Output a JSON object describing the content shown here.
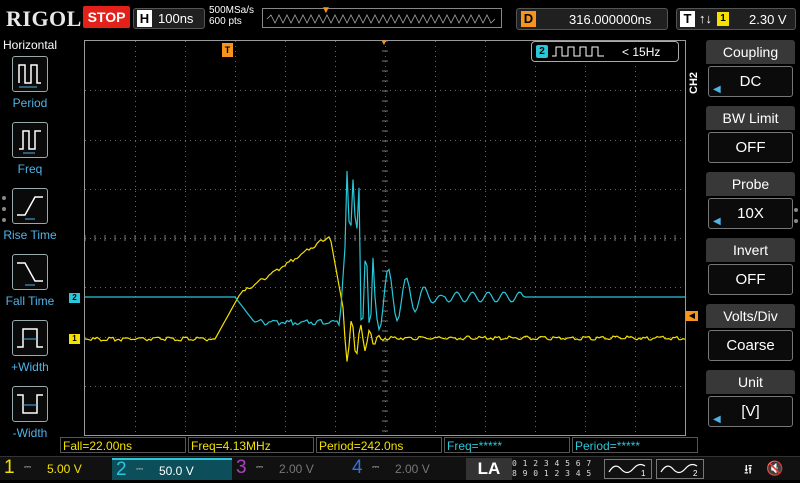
{
  "brand": {
    "logo": "RIGOL",
    "run_state": "STOP"
  },
  "horizontal": {
    "label": "H",
    "timebase": "100ns",
    "sample_rate": "500MSa/s",
    "memory_depth": "600 pts"
  },
  "delay": {
    "label": "D",
    "value": "316.000000ns"
  },
  "trigger": {
    "label": "T",
    "edge_symbol": "↑↓",
    "source": "1",
    "level": "2.30 V"
  },
  "left_menu": {
    "title": "Horizontal",
    "items": [
      {
        "label": "Period",
        "icon": "period-icon"
      },
      {
        "label": "Freq",
        "icon": "freq-icon"
      },
      {
        "label": "Rise Time",
        "icon": "rise-time-icon"
      },
      {
        "label": "Fall Time",
        "icon": "fall-time-icon"
      },
      {
        "label": "+Width",
        "icon": "positive-width-icon"
      },
      {
        "label": "-Width",
        "icon": "negative-width-icon"
      }
    ]
  },
  "generator": {
    "channel": "2",
    "freq": "< 15Hz"
  },
  "markers": {
    "trigger_pos": "T",
    "ch2": "2",
    "ch1": "1"
  },
  "measurements": [
    {
      "text": "Fall=22.00ns",
      "color": "#f5e100"
    },
    {
      "text": "Freq=4.13MHz",
      "color": "#f5e100"
    },
    {
      "text": "Period=242.0ns",
      "color": "#f5e100"
    },
    {
      "text": "Freq=*****",
      "color": "#28c7d9"
    },
    {
      "text": "Period=*****",
      "color": "#28c7d9"
    }
  ],
  "right_menu": {
    "channel_tag": "CH2",
    "items": [
      {
        "title": "Coupling",
        "value": "DC"
      },
      {
        "title": "BW Limit",
        "value": "OFF"
      },
      {
        "title": "Probe",
        "value": "10X"
      },
      {
        "title": "Invert",
        "value": "OFF"
      },
      {
        "title": "Volts/Div",
        "value": "Coarse"
      },
      {
        "title": "Unit",
        "value": "[V]"
      }
    ]
  },
  "channels": [
    {
      "num": "1",
      "scale": "5.00 V",
      "color": "#f5e100",
      "active": false
    },
    {
      "num": "2",
      "scale": "50.0 V",
      "color": "#28c7d9",
      "active": true
    },
    {
      "num": "3",
      "scale": "2.00 V",
      "color": "#b03fc8",
      "active": false
    },
    {
      "num": "4",
      "scale": "2.00 V",
      "color": "#3b6fd8",
      "active": false
    }
  ],
  "la": {
    "label": "LA",
    "digits_row1": "0 1 2 3  4 5 6 7",
    "digits_row2": "8 9 0 1  2 3 4 5"
  },
  "colors": {
    "ch1": "#f5e100",
    "ch2": "#28c7d9",
    "trigger": "#f7941d",
    "menu_blue": "#4fb3e8"
  }
}
